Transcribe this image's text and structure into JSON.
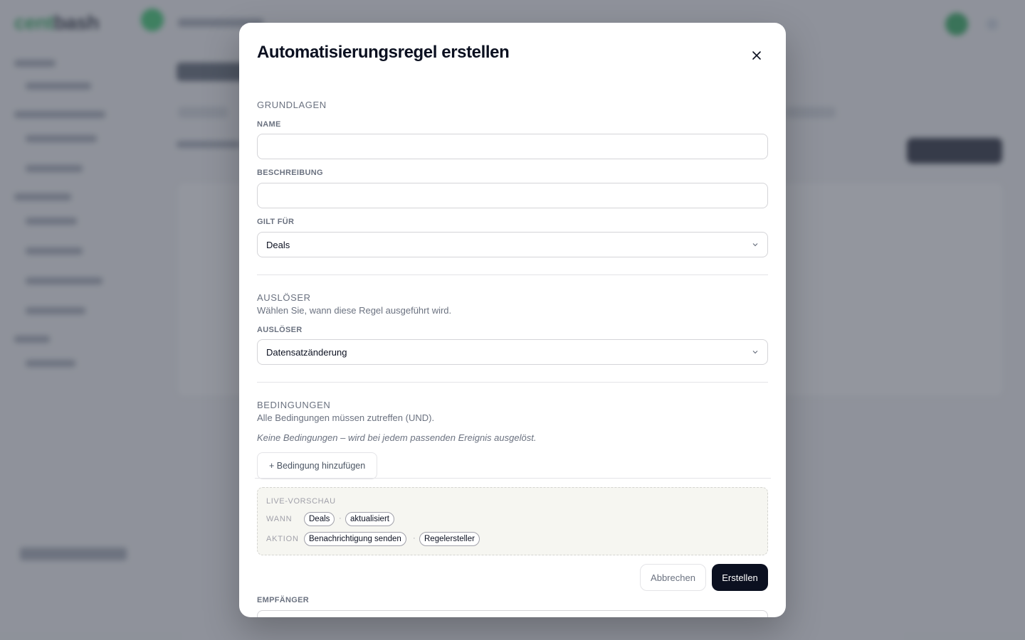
{
  "background": {
    "logo_left": "cent",
    "logo_right": "bash"
  },
  "modal": {
    "title": "Automatisierungsregel erstellen",
    "close_icon": "close-icon"
  },
  "basics": {
    "heading": "GRUNDLAGEN",
    "name_label": "NAME",
    "name_value": "",
    "description_label": "BESCHREIBUNG",
    "description_value": "",
    "applies_label": "GILT FÜR",
    "applies_value": "Deals"
  },
  "trigger": {
    "heading": "AUSLÖSER",
    "subtitle": "Wählen Sie, wann diese Regel ausgeführt wird.",
    "label": "AUSLÖSER",
    "value": "Datensatzänderung"
  },
  "conditions": {
    "heading": "BEDINGUNGEN",
    "subtitle": "Alle Bedingungen müssen zutreffen (UND).",
    "empty_hint": "Keine Bedingungen – wird bei jedem passenden Ereignis ausgelöst.",
    "add_button": "+ Bedingung hinzufügen"
  },
  "preview": {
    "title": "LIVE-VORSCHAU",
    "when_label": "WANN",
    "when_chips": [
      "Deals",
      "aktualisiert"
    ],
    "action_label": "AKTION",
    "action_chips": [
      "Benachrichtigung senden",
      "Regelersteller"
    ],
    "separator": "·"
  },
  "footer": {
    "cancel": "Abbrechen",
    "create": "Erstellen"
  },
  "peek": {
    "label": "EMPFÄNGER"
  }
}
